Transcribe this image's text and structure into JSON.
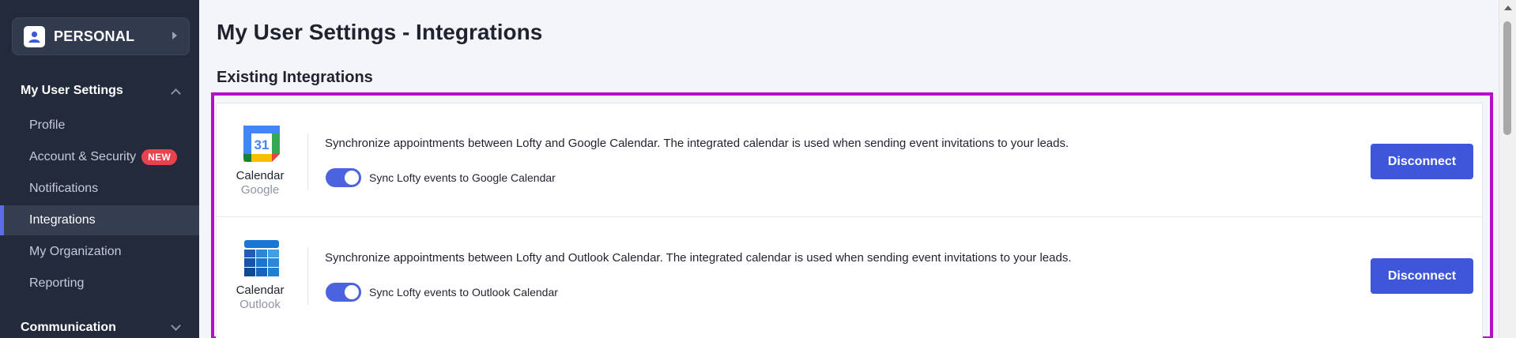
{
  "sidebar": {
    "workspace": "PERSONAL",
    "sections": [
      {
        "title": "My User Settings",
        "items": [
          {
            "label": "Profile"
          },
          {
            "label": "Account & Security",
            "badge": "NEW"
          },
          {
            "label": "Notifications"
          },
          {
            "label": "Integrations",
            "active": true
          },
          {
            "label": "My Organization"
          },
          {
            "label": "Reporting"
          }
        ]
      },
      {
        "title": "Communication"
      }
    ]
  },
  "main": {
    "title": "My User Settings - Integrations",
    "section_title": "Existing Integrations",
    "integrations": [
      {
        "name": "Calendar",
        "provider": "Google",
        "icon": "google-calendar-icon",
        "description": "Synchronize appointments between Lofty and Google Calendar. The integrated calendar is used when sending event invitations to your leads.",
        "toggle_label": "Sync Lofty events to Google Calendar",
        "toggle_on": true,
        "button_label": "Disconnect"
      },
      {
        "name": "Calendar",
        "provider": "Outlook",
        "icon": "outlook-calendar-icon",
        "description": "Synchronize appointments between Lofty and Outlook Calendar. The integrated calendar is used when sending event invitations to your leads.",
        "toggle_label": "Sync Lofty events to Outlook Calendar",
        "toggle_on": true,
        "button_label": "Disconnect"
      }
    ],
    "google_calendar_day": "31"
  },
  "colors": {
    "sidebar_bg": "#222a3b",
    "accent": "#3d56da",
    "badge": "#e8424e",
    "highlight": "#b30fc4"
  }
}
